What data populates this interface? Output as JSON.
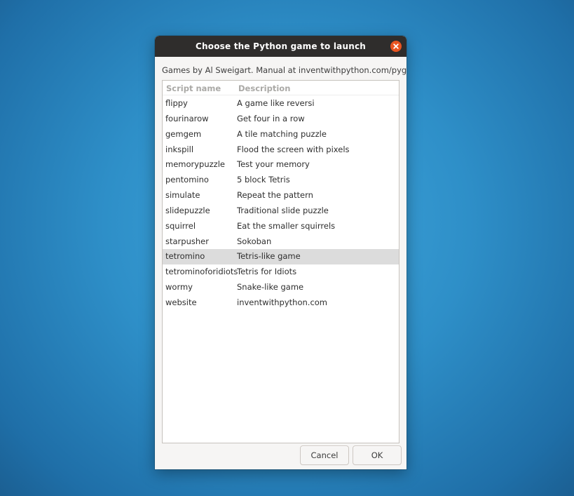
{
  "window": {
    "title": "Choose the Python game to launch",
    "close_icon": "close-icon",
    "accent_color": "#e95420"
  },
  "subtitle": "Games by Al Sweigart. Manual at inventwithpython.com/pygame",
  "list": {
    "columns": [
      "Script name",
      "Description"
    ],
    "selected_index": 10,
    "rows": [
      {
        "name": "flippy",
        "description": "A game like reversi"
      },
      {
        "name": "fourinarow",
        "description": "Get four in a row"
      },
      {
        "name": "gemgem",
        "description": "A tile matching puzzle"
      },
      {
        "name": "inkspill",
        "description": "Flood the screen with pixels"
      },
      {
        "name": "memorypuzzle",
        "description": "Test your memory"
      },
      {
        "name": "pentomino",
        "description": "5 block Tetris"
      },
      {
        "name": "simulate",
        "description": "Repeat the pattern"
      },
      {
        "name": "slidepuzzle",
        "description": "Traditional slide puzzle"
      },
      {
        "name": "squirrel",
        "description": "Eat the smaller squirrels"
      },
      {
        "name": "starpusher",
        "description": "Sokoban"
      },
      {
        "name": "tetromino",
        "description": "Tetris-like game"
      },
      {
        "name": "tetrominoforidiots",
        "description": "Tetris for Idiots"
      },
      {
        "name": "wormy",
        "description": "Snake-like game"
      },
      {
        "name": "website",
        "description": "inventwithpython.com"
      }
    ]
  },
  "buttons": {
    "cancel_label": "Cancel",
    "ok_label": "OK"
  }
}
